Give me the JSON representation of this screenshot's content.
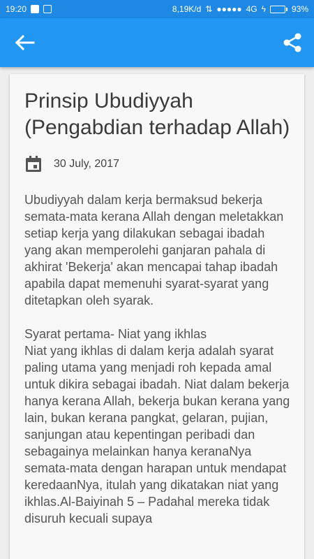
{
  "status_bar": {
    "time": "19:20",
    "network_speed": "8,19K/d",
    "network_type": "4G",
    "battery": "93%",
    "battery_level": 0.93
  },
  "app_bar": {
    "back_icon": "arrow-left-icon",
    "share_icon": "share-icon",
    "color": "#2196f3"
  },
  "article": {
    "title": "Prinsip Ubudiyyah (Pengabdian terhadap Allah)",
    "date_icon": "calendar-icon",
    "date": "30 July, 2017",
    "paragraph_1": "Ubudiyyah dalam kerja bermaksud bekerja semata-mata kerana Allah dengan meletakkan setiap kerja yang dilakukan sebagai ibadah yang akan memperolehi ganjaran pahala di akhirat 'Bekerja' akan mencapai tahap ibadah apabila dapat memenuhi syarat-syarat yang ditetapkan oleh syarak.",
    "subheading_1": "Syarat pertama- Niat yang ikhlas",
    "paragraph_2": "Niat yang ikhlas di dalam kerja adalah syarat paling utama yang menjadi roh kepada amal untuk dikira sebagai ibadah. Niat dalam bekerja hanya kerana Allah, bekerja bukan kerana yang lain, bukan kerana pangkat, gelaran, pujian, sanjungan atau kepentingan peribadi dan sebagainya melainkan hanya keranaNya semata-mata dengan harapan untuk mendapat keredaanNya, itulah yang dikatakan niat yang ikhlas.Al-Baiyinah 5 – Padahal mereka tidak disuruh kecuali supaya"
  }
}
